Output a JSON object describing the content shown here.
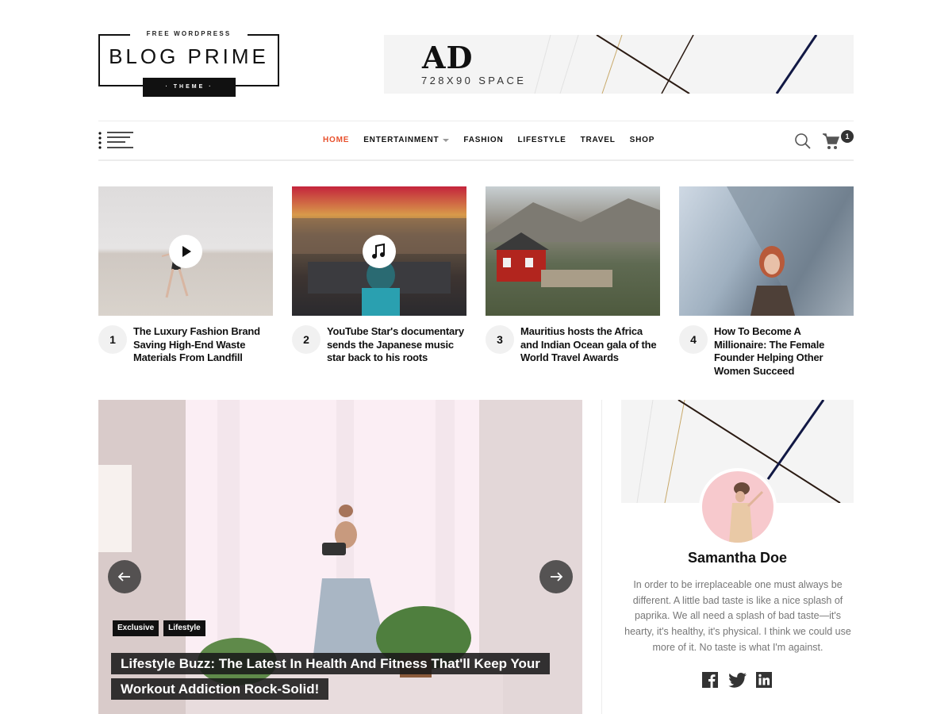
{
  "logo": {
    "top_text": "FREE WORDPRESS",
    "main_text": "BLOG PRIME",
    "sub_text": "· THEME ·"
  },
  "ad": {
    "big_text": "AD",
    "small_text": "728X90 SPACE"
  },
  "nav": {
    "items": [
      {
        "label": "HOME",
        "active": true
      },
      {
        "label": "ENTERTAINMENT",
        "has_dropdown": true
      },
      {
        "label": "FASHION"
      },
      {
        "label": "LIFESTYLE"
      },
      {
        "label": "TRAVEL"
      },
      {
        "label": "SHOP"
      }
    ],
    "cart_count": "1",
    "accent_color": "#e8512d"
  },
  "featured": [
    {
      "number": "1",
      "title": "The Luxury Fashion Brand Saving High-End Waste Materials From Landfill",
      "media_icon": "play-icon"
    },
    {
      "number": "2",
      "title": "YouTube Star's documentary sends the Japanese music star back to his roots",
      "media_icon": "music-note-icon"
    },
    {
      "number": "3",
      "title": "Mauritius hosts the Africa and Indian Ocean gala of the World Travel Awards",
      "media_icon": ""
    },
    {
      "number": "4",
      "title": "How To Become A Millionaire: The Female Founder Helping Other Women Succeed",
      "media_icon": ""
    }
  ],
  "slider": {
    "tags": [
      "Exclusive",
      "Lifestyle"
    ],
    "title": "Lifestyle Buzz: The Latest In Health And Fitness That'll Keep Your Workout Addiction Rock-Solid!"
  },
  "author": {
    "name": "Samantha Doe",
    "bio": "In order to be irreplaceable one must always be different. A little bad taste is like a nice splash of paprika. We all need a splash of bad taste—it's hearty, it's healthy, it's physical. I think we could use more of it. No taste is what I'm against.",
    "socials": [
      "facebook-icon",
      "twitter-icon",
      "linkedin-icon"
    ]
  }
}
